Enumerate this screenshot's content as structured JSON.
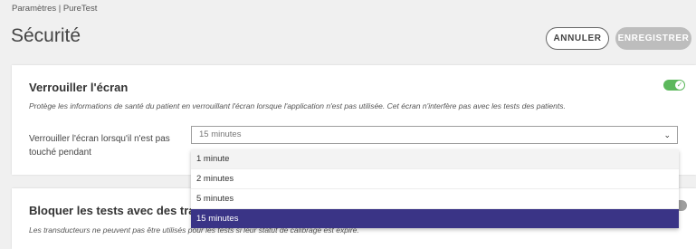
{
  "header": {
    "breadcrumb": "Paramètres | PureTest",
    "title": "Sécurité",
    "cancel_label": "ANNULER",
    "save_label": "ENREGISTRER"
  },
  "lock_screen": {
    "title": "Verrouiller l'écran",
    "description": "Protège les informations de santé du patient en verrouillant l'écran lorsque l'application n'est pas utilisée. Cet écran n'interfère pas avec les tests des patients.",
    "enabled": true,
    "field_label": "Verrouiller l'écran lorsqu'il n'est pas touché pendant",
    "selected_value": "15 minutes",
    "options": [
      "1 minute",
      "2 minutes",
      "5 minutes",
      "15 minutes"
    ]
  },
  "block_tests": {
    "title": "Bloquer les tests avec des tra",
    "description": "Les transducteurs ne peuvent pas être utilisés pour les tests si leur statut de calibrage est expiré.",
    "enabled": false
  },
  "colors": {
    "accent": "#3a3486",
    "toggle_on": "#5cb85c"
  }
}
